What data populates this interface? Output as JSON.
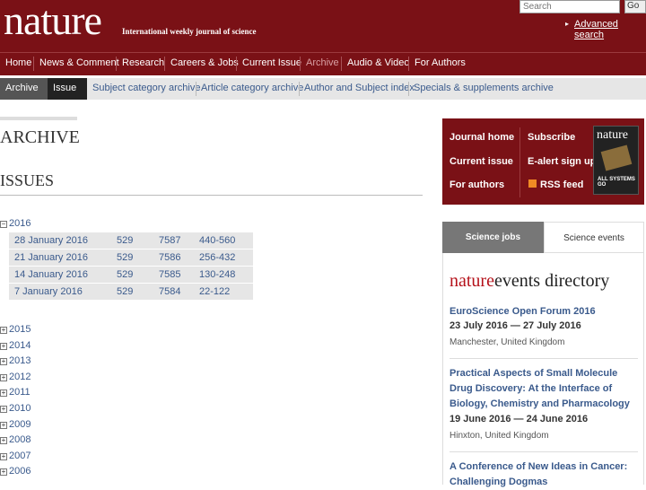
{
  "header": {
    "logo": "nature",
    "tagline": "International weekly journal of science",
    "search_placeholder": "Search",
    "go_label": "Go",
    "advanced_search": "Advanced search"
  },
  "nav": {
    "items": [
      "Home",
      "News & Comment",
      "Research",
      "Careers & Jobs",
      "Current Issue",
      "Archive",
      "Audio & Video",
      "For Authors"
    ],
    "active": "Archive"
  },
  "subnav": {
    "breadcrumb": [
      "Archive",
      "Issue"
    ],
    "links": [
      "Subject category archive",
      "Article category archive",
      "Author and Subject index",
      "Specials & supplements archive"
    ]
  },
  "main": {
    "archive_heading": "ARCHIVE",
    "issues_heading": "ISSUES",
    "expanded_year": "2016",
    "issues": [
      {
        "date": "28 January 2016",
        "volume": "529",
        "number": "7587",
        "pages": "440-560"
      },
      {
        "date": "21 January 2016",
        "volume": "529",
        "number": "7586",
        "pages": "256-432"
      },
      {
        "date": "14 January 2016",
        "volume": "529",
        "number": "7585",
        "pages": "130-248"
      },
      {
        "date": "7 January 2016",
        "volume": "529",
        "number": "7584",
        "pages": "22-122"
      }
    ],
    "collapsed_years": [
      "2015",
      "2014",
      "2013",
      "2012",
      "2011",
      "2010",
      "2009",
      "2008",
      "2007",
      "2006"
    ]
  },
  "sidebar": {
    "links_left": [
      "Journal home",
      "Current issue",
      "For authors"
    ],
    "links_right": [
      "Subscribe",
      "E-alert sign up",
      "RSS feed"
    ],
    "cover_title": "nature",
    "cover_caption": "ALL SYSTEMS GO",
    "tabs": [
      "Science jobs",
      "Science events"
    ],
    "events_brand_a": "nature",
    "events_brand_b": "events directory",
    "events": [
      {
        "title": "EuroScience Open Forum 2016",
        "dates": "23 July 2016 — 27 July 2016",
        "location": "Manchester, United Kingdom"
      },
      {
        "title": "Practical Aspects of Small Molecule Drug Discovery: At the Interface of Biology, Chemistry and Pharmacology",
        "dates": "19 June 2016 — 24 June 2016",
        "location": "Hinxton, United Kingdom"
      },
      {
        "title": "A Conference of New Ideas in Cancer: Challenging Dogmas",
        "dates": "",
        "location": ""
      }
    ]
  },
  "colors": {
    "brand": "#7a1116",
    "link": "#3a5a8c",
    "rss": "#f08a24"
  }
}
